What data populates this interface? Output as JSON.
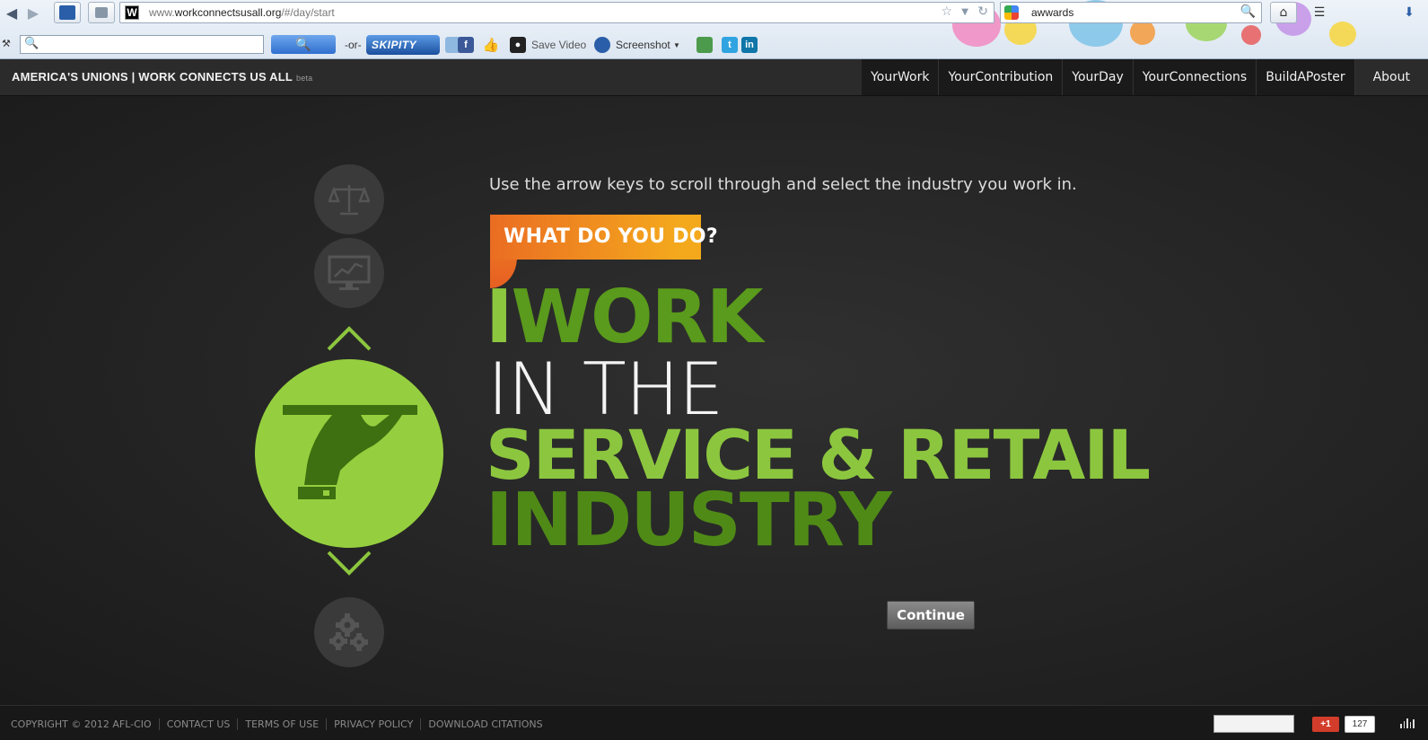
{
  "browser": {
    "url_host": "www.",
    "url_domain": "workconnectsusall.org",
    "url_path": "/#/day/start",
    "favicon_letter": "W",
    "search_value": "awwards",
    "toolbar": {
      "or_label": "-or-",
      "skipity_label": "SKIPITY",
      "save_video_label": "Save Video",
      "screenshot_label": "Screenshot"
    }
  },
  "site": {
    "brand": "AMERICA'S UNIONS | WORK CONNECTS US ALL",
    "beta": "beta",
    "nav": [
      "YourWork",
      "YourContribution",
      "YourDay",
      "YourConnections",
      "BuildAPoster",
      "About"
    ]
  },
  "main": {
    "instructions": "Use the arrow keys to scroll through and select the industry you work in.",
    "badge": "WHAT DO YOU DO?",
    "line1_i": "I",
    "line1_work": "WORK",
    "line2": "IN THE",
    "line3": "SERVICE & RETAIL",
    "line4": "INDUSTRY",
    "continue": "Continue",
    "accent_green": "#8cc63f",
    "dark_green": "#4f8a17",
    "badge_orange": "#ea6d22"
  },
  "footer": {
    "links": [
      "COPYRIGHT © 2012 AFL-CIO",
      "CONTACT US",
      "TERMS OF USE",
      "PRIVACY POLICY",
      "DOWNLOAD CITATIONS"
    ],
    "gplus": "+1",
    "gplus_count": "127"
  }
}
